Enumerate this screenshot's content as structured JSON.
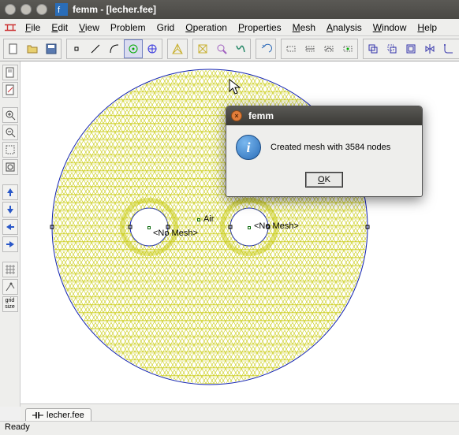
{
  "window": {
    "title": "femm - [lecher.fee]"
  },
  "menu": {
    "file": "File",
    "edit": "Edit",
    "view": "View",
    "problem": "Problem",
    "grid": "Grid",
    "operation": "Operation",
    "properties": "Properties",
    "mesh": "Mesh",
    "analysis": "Analysis",
    "window": "Window",
    "help": "Help"
  },
  "canvas": {
    "air_label": "Air",
    "no_mesh_1": "<No Mesh>",
    "no_mesh_2": "<No Mesh>"
  },
  "left_tool_grid_size": "grid\nsize",
  "tab": {
    "label": "lecher.fee"
  },
  "status": {
    "text": "Ready"
  },
  "dialog": {
    "title": "femm",
    "message": "Created mesh with 3584 nodes",
    "ok": "OK"
  }
}
